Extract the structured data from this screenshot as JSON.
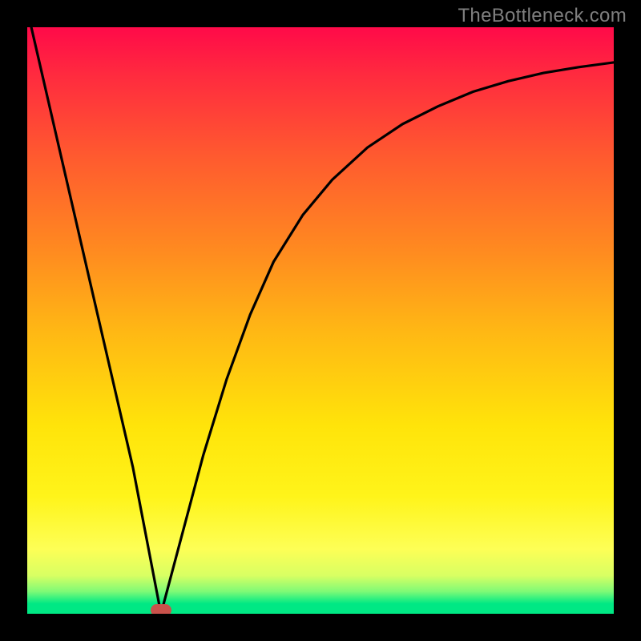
{
  "watermark": "TheBottleneck.com",
  "chart_data": {
    "type": "line",
    "title": "",
    "xlabel": "",
    "ylabel": "",
    "xlim": [
      0,
      100
    ],
    "ylim": [
      0,
      100
    ],
    "grid": false,
    "series": [
      {
        "name": "bottleneck-curve",
        "x": [
          0,
          6,
          12,
          18,
          22.8,
          26,
          30,
          34,
          38,
          42,
          47,
          52,
          58,
          64,
          70,
          76,
          82,
          88,
          94,
          100
        ],
        "values": [
          103,
          77,
          51,
          25,
          0,
          12,
          27,
          40,
          51,
          60,
          68,
          74,
          79.5,
          83.5,
          86.5,
          89,
          90.8,
          92.2,
          93.2,
          94
        ]
      }
    ],
    "marker": {
      "x": 22.8,
      "y": 0,
      "label": "optimal-point"
    },
    "background_gradient": {
      "stops": [
        {
          "pct": 0,
          "color": "#ff0a49"
        },
        {
          "pct": 22,
          "color": "#ff5a2f"
        },
        {
          "pct": 52,
          "color": "#ffb814"
        },
        {
          "pct": 80,
          "color": "#fff41a"
        },
        {
          "pct": 96,
          "color": "#7ffa76"
        },
        {
          "pct": 100,
          "color": "#00e884"
        }
      ]
    }
  }
}
